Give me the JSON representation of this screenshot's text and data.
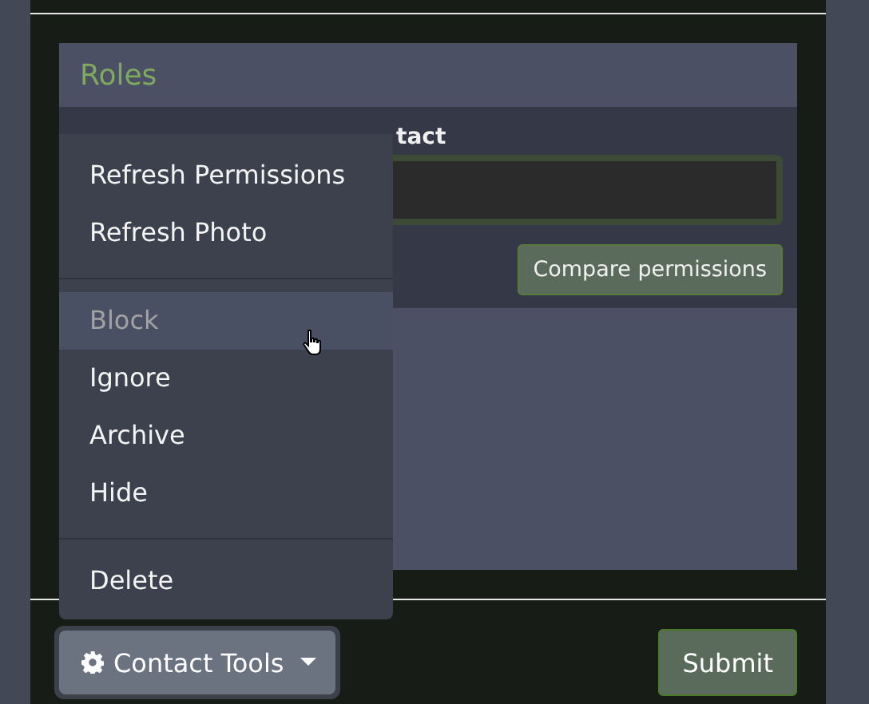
{
  "card": {
    "title": "Roles",
    "label": "tact",
    "compare_button": "Compare permissions"
  },
  "dropdown": {
    "items": [
      {
        "kind": "item",
        "label": "Refresh Permissions",
        "highlighted": false,
        "disabled": false
      },
      {
        "kind": "item",
        "label": "Refresh Photo",
        "highlighted": false,
        "disabled": false
      },
      {
        "kind": "divider"
      },
      {
        "kind": "item",
        "label": "Block",
        "highlighted": true,
        "disabled": true
      },
      {
        "kind": "item",
        "label": "Ignore",
        "highlighted": false,
        "disabled": false
      },
      {
        "kind": "item",
        "label": "Archive",
        "highlighted": false,
        "disabled": false
      },
      {
        "kind": "item",
        "label": "Hide",
        "highlighted": false,
        "disabled": false
      },
      {
        "kind": "divider"
      },
      {
        "kind": "item",
        "label": "Delete",
        "highlighted": false,
        "disabled": false
      }
    ]
  },
  "footer": {
    "tools_button": "Contact Tools",
    "submit_button": "Submit"
  }
}
